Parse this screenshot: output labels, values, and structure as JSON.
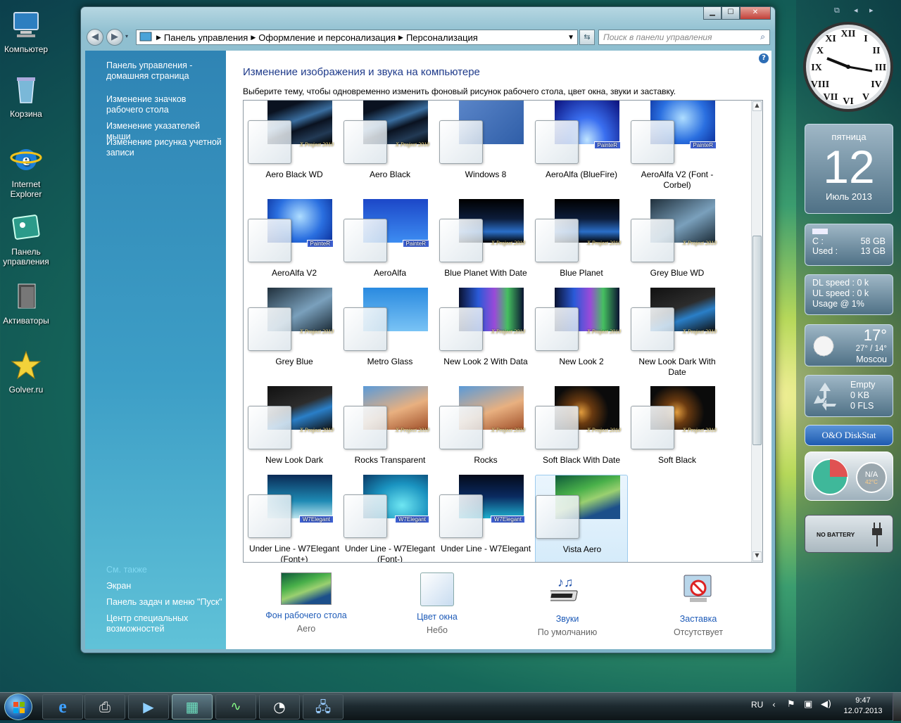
{
  "desktop": {
    "icons": [
      {
        "label": "Компьютер"
      },
      {
        "label": "Корзина"
      },
      {
        "label": "Internet Explorer"
      },
      {
        "label": "Панель управления"
      },
      {
        "label": "Активаторы"
      },
      {
        "label": "Golver.ru"
      }
    ]
  },
  "window": {
    "breadcrumbs": [
      "Панель управления",
      "Оформление и персонализация",
      "Персонализация"
    ],
    "search_placeholder": "Поиск в панели управления",
    "caption_buttons": {
      "minimize": "▁",
      "maximize": "☐",
      "close": "✕"
    }
  },
  "left_pane": {
    "links": [
      "Панель управления - домашняя страница",
      "Изменение значков рабочего стола",
      "Изменение указателей мыши",
      "Изменение рисунка учетной записи"
    ],
    "see_also_title": "См. также",
    "see_also": [
      "Экран",
      "Панель задач и меню \"Пуск\"",
      "Центр специальных возможностей"
    ]
  },
  "main": {
    "help": "?",
    "title": "Изменение изображения и звука на компьютере",
    "description": "Выберите тему, чтобы одновременно изменить фоновый рисунок рабочего стола, цвет окна, звуки и заставку.",
    "themes": [
      {
        "label": "Aero Black WD",
        "badge": "X Project 2010",
        "wp": "black"
      },
      {
        "label": "Aero Black",
        "badge": "X Project 2010",
        "wp": "black"
      },
      {
        "label": "Windows 8",
        "badge": "",
        "wp": "win8"
      },
      {
        "label": "AeroAlfa (BlueFire)",
        "badge": "PainteR",
        "wp": "bluefire"
      },
      {
        "label": "AeroAlfa V2 (Font - Corbel)",
        "badge": "PainteR",
        "wp": "alfa"
      },
      {
        "label": "AeroAlfa V2",
        "badge": "PainteR",
        "wp": "alfa"
      },
      {
        "label": "AeroAlfa",
        "badge": "PainteR",
        "wp": "alfa2"
      },
      {
        "label": "Blue Planet With Date",
        "badge": "X Project 2010",
        "wp": "planet"
      },
      {
        "label": "Blue Planet",
        "badge": "X Project 2010",
        "wp": "planet"
      },
      {
        "label": "Grey Blue WD",
        "badge": "X Project 2010",
        "wp": "greyblue"
      },
      {
        "label": "Grey Blue",
        "badge": "X Project 2010",
        "wp": "greyblue"
      },
      {
        "label": "Metro Glass",
        "badge": "",
        "wp": "daisy"
      },
      {
        "label": "New Look 2 With Data",
        "badge": "X Project 2010",
        "wp": "newlook"
      },
      {
        "label": "New Look 2",
        "badge": "X Project 2010",
        "wp": "newlook"
      },
      {
        "label": "New Look Dark With Date",
        "badge": "X Project 2010",
        "wp": "dark"
      },
      {
        "label": "New Look Dark",
        "badge": "X Project 2010",
        "wp": "dark"
      },
      {
        "label": "Rocks Transparent",
        "badge": "X Project 2010",
        "wp": "rocks"
      },
      {
        "label": "Rocks",
        "badge": "X Project 2010",
        "wp": "rocks"
      },
      {
        "label": "Soft Black With Date",
        "badge": "X Project 2010",
        "wp": "bokeh"
      },
      {
        "label": "Soft Black",
        "badge": "X Project 2010",
        "wp": "bokeh"
      },
      {
        "label": "Under Line - W7Elegant (Font+)",
        "badge": "W7Elegant",
        "wp": "under1"
      },
      {
        "label": "Under Line - W7Elegant (Font-)",
        "badge": "W7Elegant",
        "wp": "under2"
      },
      {
        "label": "Under Line - W7Elegant",
        "badge": "W7Elegant",
        "wp": "under3"
      },
      {
        "label": "Vista Aero",
        "badge": "",
        "wp": "vista",
        "selected": true
      }
    ],
    "options": [
      {
        "name": "Фон рабочего стола",
        "value": "Aero",
        "icon": "desktop-background-icon"
      },
      {
        "name": "Цвет окна",
        "value": "Небо",
        "icon": "window-color-icon"
      },
      {
        "name": "Звуки",
        "value": "По умолчанию",
        "icon": "sounds-icon"
      },
      {
        "name": "Заставка",
        "value": "Отсутствует",
        "icon": "screensaver-icon"
      }
    ]
  },
  "gadgets": {
    "calendar": {
      "weekday": "пятница",
      "day": "12",
      "month_year": "Июль 2013"
    },
    "drive": {
      "c_label": "C :",
      "c_value": "58 GB",
      "used_label": "Used :",
      "used_value": "13 GB"
    },
    "network": {
      "dl": "DL speed : 0 k",
      "ul": "UL speed : 0 k",
      "usage": "Usage @ 1%"
    },
    "weather": {
      "temp": "17°",
      "range": "27° / 14°",
      "city": "Moscou"
    },
    "recycle": {
      "status": "Empty",
      "size": "0 KB",
      "files": "0 FLS"
    },
    "diskstat": {
      "label": "O&O DiskStat"
    },
    "meter": {
      "right": "N/A",
      "temp": "42°C"
    },
    "battery": {
      "label": "NO BATTERY"
    }
  },
  "taskbar": {
    "lang": "RU",
    "time": "9:47",
    "date": "12.07.2013"
  }
}
